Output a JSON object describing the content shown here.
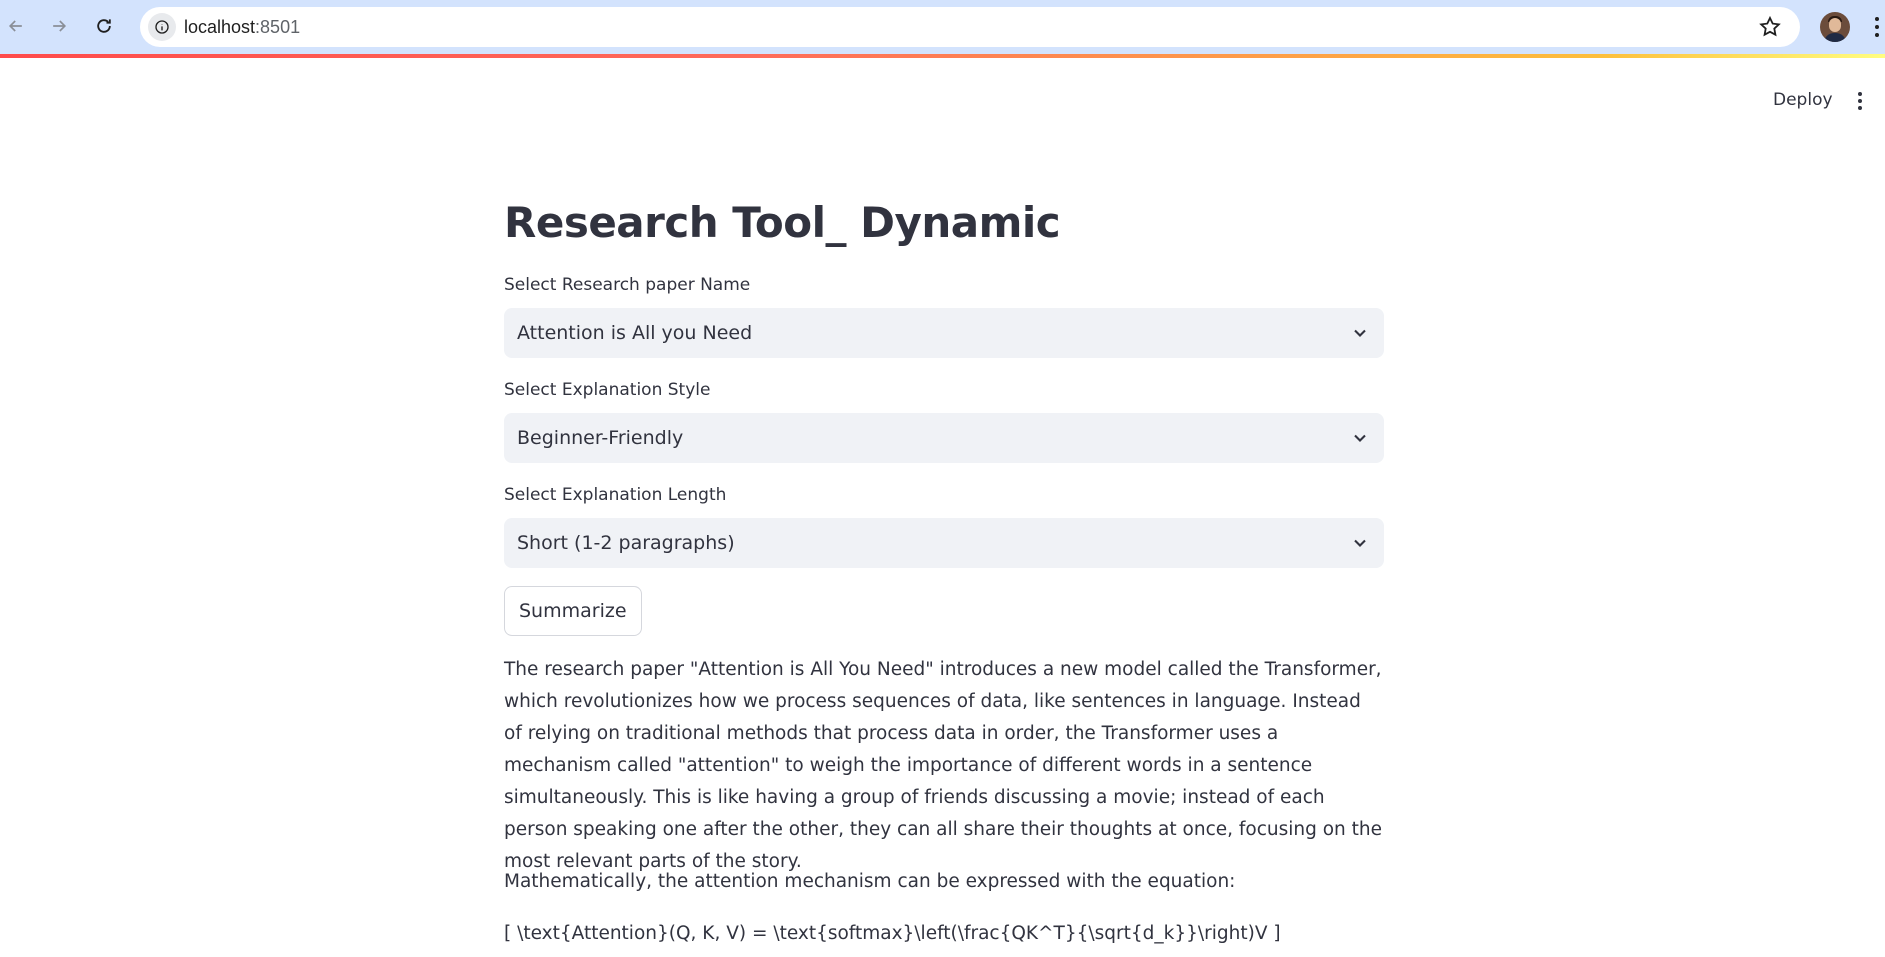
{
  "browser": {
    "url_host": "localhost",
    "url_port": ":8501"
  },
  "header": {
    "deploy_label": "Deploy"
  },
  "main": {
    "title": "Research Tool_ Dynamic",
    "fields": [
      {
        "label": "Select Research paper Name",
        "value": "Attention is All you Need"
      },
      {
        "label": "Select Explanation Style",
        "value": "Beginner-Friendly"
      },
      {
        "label": "Select Explanation Length",
        "value": "Short (1-2 paragraphs)"
      }
    ],
    "summarize_label": "Summarize",
    "output": {
      "paragraph1": "The research paper \"Attention is All You Need\" introduces a new model called the Transformer, which revolutionizes how we process sequences of data, like sentences in language. Instead of relying on traditional methods that process data in order, the Transformer uses a mechanism called \"attention\" to weigh the importance of different words in a sentence simultaneously. This is like having a group of friends discussing a movie; instead of each person speaking one after the other, they can all share their thoughts at once, focusing on the most relevant parts of the story.",
      "paragraph2": "Mathematically, the attention mechanism can be expressed with the equation:",
      "equation": "[ \\text{Attention}(Q, K, V) = \\text{softmax}\\left(\\frac{QK^T}{\\sqrt{d_k}}\\right)V ]"
    }
  },
  "colors": {
    "chrome_bg": "#d3e3fd",
    "select_bg": "#f0f2f6",
    "text": "#31333f",
    "accent": "#ff4b4b"
  },
  "icons": [
    "back-arrow-icon",
    "forward-arrow-icon",
    "reload-icon",
    "info-icon",
    "star-icon",
    "avatar",
    "kebab-menu-icon",
    "chevron-down-icon"
  ]
}
